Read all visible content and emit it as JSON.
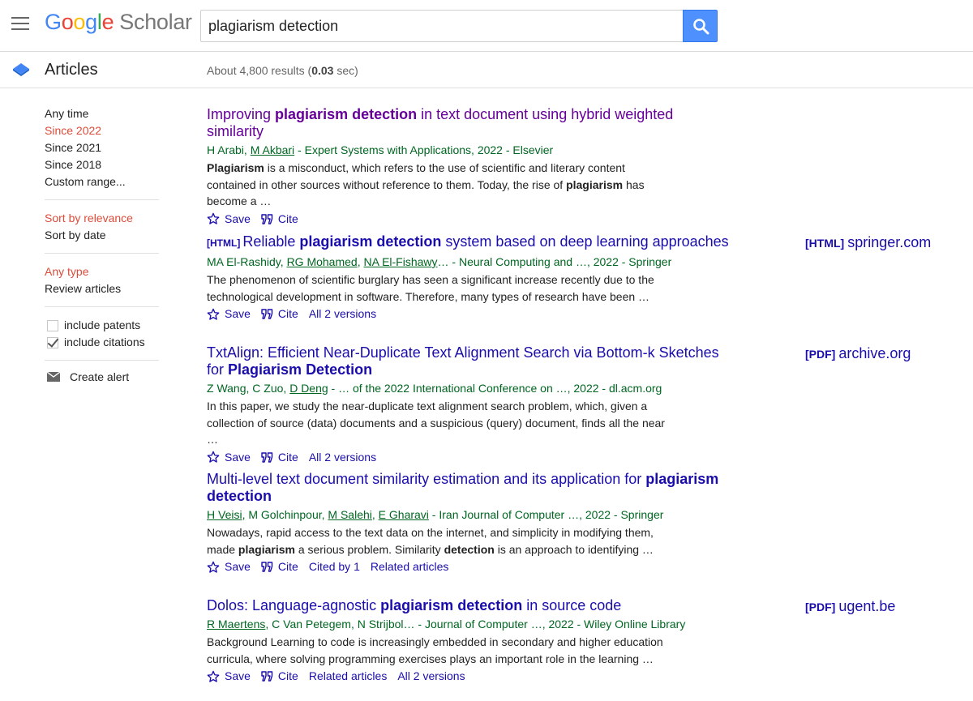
{
  "header": {
    "logo_google": [
      "G",
      "o",
      "o",
      "g",
      "l",
      "e"
    ],
    "logo_scholar": "Scholar",
    "search_value": "plagiarism detection"
  },
  "subbar": {
    "section_label": "Articles",
    "results_prefix": "About 4,800 results (",
    "results_time": "0.03",
    "results_suffix": " sec)"
  },
  "sidebar": {
    "time_filters": [
      {
        "label": "Any time",
        "selected": false
      },
      {
        "label": "Since 2022",
        "selected": true
      },
      {
        "label": "Since 2021",
        "selected": false
      },
      {
        "label": "Since 2018",
        "selected": false
      },
      {
        "label": "Custom range...",
        "selected": false
      }
    ],
    "sort_options": [
      {
        "label": "Sort by relevance",
        "selected": true
      },
      {
        "label": "Sort by date",
        "selected": false
      }
    ],
    "type_options": [
      {
        "label": "Any type",
        "selected": true
      },
      {
        "label": "Review articles",
        "selected": false
      }
    ],
    "include_patents": {
      "label": "include patents",
      "checked": false
    },
    "include_citations": {
      "label": "include citations",
      "checked": true
    },
    "create_alert": "Create alert"
  },
  "results": [
    {
      "title_parts": [
        {
          "t": "Improving ",
          "b": false
        },
        {
          "t": "plagiarism detection",
          "b": true
        },
        {
          "t": " in text document using hybrid weighted similarity",
          "b": false
        }
      ],
      "visited": true,
      "meta": {
        "authors": [
          {
            "name": "H Arabi",
            "link": false
          },
          {
            "name": "M Akbari",
            "link": true
          }
        ],
        "rest": " - Expert Systems with Applications, 2022 - Elsevier"
      },
      "snippet": [
        {
          "t": "Plagiarism",
          "b": true
        },
        {
          "t": " is a misconduct, which refers to the use of scientific and literary content contained in other sources without reference to them. Today, the rise of ",
          "b": false
        },
        {
          "t": "plagiarism",
          "b": true
        },
        {
          "t": " has become a …",
          "b": false
        }
      ],
      "save": "Save",
      "cite": "Cite",
      "extra_links": []
    },
    {
      "tag": "[HTML]",
      "title_parts": [
        {
          "t": "Reliable ",
          "b": false
        },
        {
          "t": "plagiarism detection",
          "b": true
        },
        {
          "t": " system based on deep learning approaches",
          "b": false
        }
      ],
      "visited": false,
      "meta": {
        "authors": [
          {
            "name": "MA El-Rashidy",
            "link": false
          },
          {
            "name": "RG Mohamed",
            "link": true
          },
          {
            "name": "NA El-Fishawy",
            "link": true
          }
        ],
        "rest": "… - Neural Computing and …, 2022 - Springer"
      },
      "snippet": [
        {
          "t": "The phenomenon of scientific burglary has seen a significant increase recently due to the technological development in software. Therefore, many types of research have been …",
          "b": false
        }
      ],
      "save": "Save",
      "cite": "Cite",
      "extra_links": [
        "All 2 versions"
      ],
      "side": {
        "tag": "[HTML]",
        "domain": "springer.com"
      }
    },
    {
      "title_parts": [
        {
          "t": "TxtAlign: Efficient Near-Duplicate Text Alignment Search via Bottom-k Sketches for ",
          "b": false
        },
        {
          "t": "Plagiarism Detection",
          "b": true
        }
      ],
      "visited": false,
      "meta": {
        "authors": [
          {
            "name": "Z Wang",
            "link": false
          },
          {
            "name": "C Zuo",
            "link": false
          },
          {
            "name": "D Deng",
            "link": true
          }
        ],
        "rest": " - … of the 2022 International Conference on …, 2022 - dl.acm.org"
      },
      "snippet": [
        {
          "t": "In this paper, we study the near-duplicate text alignment search problem, which, given a collection of source (data) documents and a suspicious (query) document, finds all the near …",
          "b": false
        }
      ],
      "save": "Save",
      "cite": "Cite",
      "extra_links": [
        "All 2 versions"
      ],
      "side": {
        "tag": "[PDF]",
        "domain": "archive.org"
      }
    },
    {
      "title_parts": [
        {
          "t": "Multi-level text document similarity estimation and its application for ",
          "b": false
        },
        {
          "t": "plagiarism detection",
          "b": true
        }
      ],
      "visited": false,
      "meta": {
        "authors": [
          {
            "name": "H Veisi",
            "link": true
          },
          {
            "name": "M Golchinpour",
            "link": false
          },
          {
            "name": "M Salehi",
            "link": true
          },
          {
            "name": "E Gharavi",
            "link": true
          }
        ],
        "rest": " - Iran Journal of Computer …, 2022 - Springer"
      },
      "snippet": [
        {
          "t": "Nowadays, rapid access to the text data on the internet, and simplicity in modifying them, made ",
          "b": false
        },
        {
          "t": "plagiarism",
          "b": true
        },
        {
          "t": " a serious problem. Similarity ",
          "b": false
        },
        {
          "t": "detection",
          "b": true
        },
        {
          "t": " is an approach to identifying …",
          "b": false
        }
      ],
      "save": "Save",
      "cite": "Cite",
      "extra_links": [
        "Cited by 1",
        "Related articles"
      ]
    },
    {
      "title_parts": [
        {
          "t": "Dolos: Language-agnostic ",
          "b": false
        },
        {
          "t": "plagiarism detection",
          "b": true
        },
        {
          "t": " in source code",
          "b": false
        }
      ],
      "visited": false,
      "meta": {
        "authors": [
          {
            "name": "R Maertens",
            "link": true
          },
          {
            "name": "C Van Petegem",
            "link": false
          },
          {
            "name": "N Strijbol",
            "link": false
          }
        ],
        "rest": "… - Journal of Computer …, 2022 - Wiley Online Library"
      },
      "snippet": [
        {
          "t": "Background Learning to code is increasingly embedded in secondary and higher education curricula, where solving programming exercises plays an important role in the learning …",
          "b": false
        }
      ],
      "save": "Save",
      "cite": "Cite",
      "extra_links": [
        "Related articles",
        "All 2 versions"
      ],
      "side": {
        "tag": "[PDF]",
        "domain": "ugent.be"
      }
    }
  ],
  "colors": {
    "link": "#1a0dab",
    "visited": "#660099",
    "meta": "#006621",
    "selected": "#dd4b39",
    "search_button": "#4d90fe"
  }
}
